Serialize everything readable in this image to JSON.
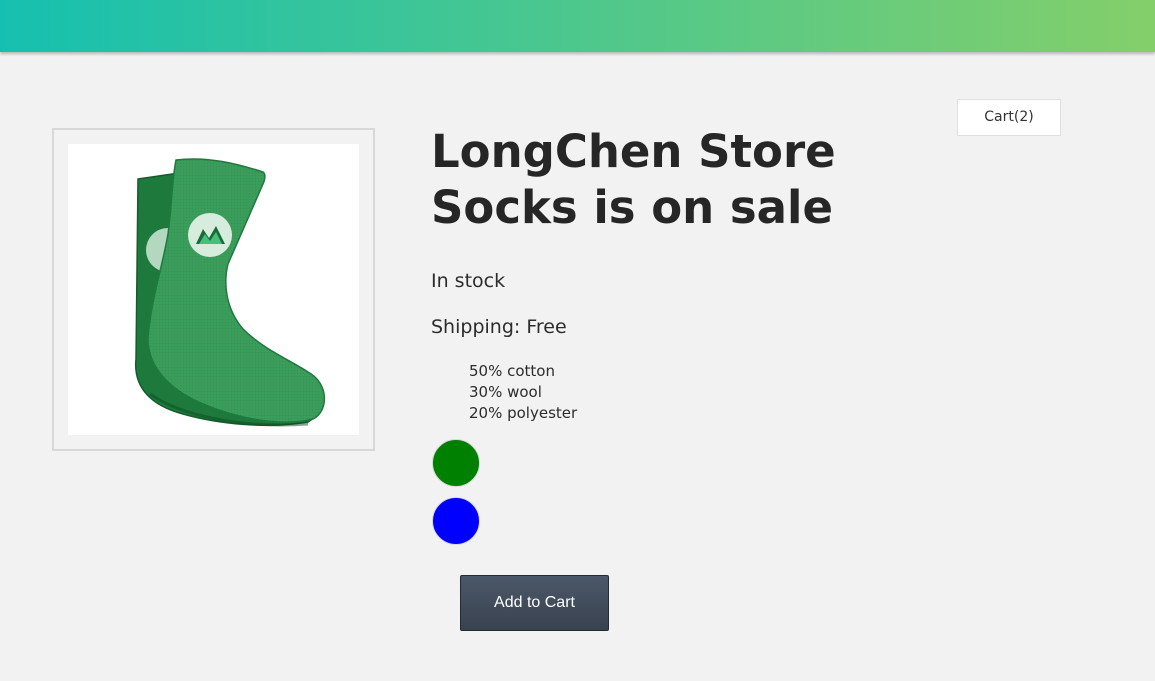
{
  "header": {
    "gradient_start": "#16c0b0",
    "gradient_end": "#84cf6a"
  },
  "cart": {
    "label": "Cart(2)"
  },
  "product": {
    "image_alt": "Green socks",
    "title_line1": "LongChen Store",
    "title_line2": "Socks is on sale",
    "stock_status": "In stock",
    "shipping": "Shipping: Free",
    "details": [
      "50% cotton",
      "30% wool",
      "20% polyester"
    ],
    "variants": [
      {
        "color": "#008000"
      },
      {
        "color": "#0000ff"
      }
    ]
  },
  "actions": {
    "add_to_cart_label": "Add to Cart"
  }
}
